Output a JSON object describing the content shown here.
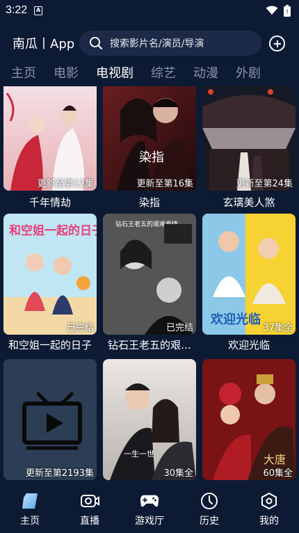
{
  "status_bar": {
    "time": "3:22",
    "app_icon_letter": "A"
  },
  "header": {
    "app_title": "南瓜丨App",
    "search_placeholder": "搜索影片名/演员/导演"
  },
  "tabs": [
    {
      "label": "主页",
      "active": false
    },
    {
      "label": "电影",
      "active": false
    },
    {
      "label": "电视剧",
      "active": true
    },
    {
      "label": "综艺",
      "active": false
    },
    {
      "label": "动漫",
      "active": false
    },
    {
      "label": "外剧",
      "active": false
    }
  ],
  "cards": [
    {
      "title": "千年情劫",
      "badge": "更新至第12集",
      "poster_text": "情劫"
    },
    {
      "title": "染指",
      "badge": "更新至第16集",
      "poster_text": "染指"
    },
    {
      "title": "玄璃美人煞",
      "badge": "更新至第24集",
      "poster_text": ""
    },
    {
      "title": "和空姐一起的日子",
      "badge": "已完结",
      "poster_text": "和空姐一起的日子"
    },
    {
      "title": "钻石王老五的艰…",
      "badge": "已完结",
      "poster_text": "钻石王老五的艰难爱情"
    },
    {
      "title": "欢迎光临",
      "badge": "37集全",
      "poster_text": "欢迎光临"
    },
    {
      "title": "",
      "badge": "更新至第2193集",
      "poster_text": ""
    },
    {
      "title": "",
      "badge": "30集全",
      "poster_text": "一生一世"
    },
    {
      "title": "",
      "badge": "60集全",
      "poster_text": "大唐"
    }
  ],
  "bottom_nav": [
    {
      "label": "主页",
      "icon": "home-icon",
      "active": true
    },
    {
      "label": "直播",
      "icon": "live-camera-icon",
      "active": false
    },
    {
      "label": "游戏厅",
      "icon": "gamepad-icon",
      "active": false
    },
    {
      "label": "历史",
      "icon": "clock-icon",
      "active": false
    },
    {
      "label": "我的",
      "icon": "profile-icon",
      "active": false
    }
  ],
  "colors": {
    "background": "#0c1a33",
    "search_bg": "#1c2a47",
    "inactive_tab": "#8993a6",
    "active_text": "#ffffff"
  }
}
